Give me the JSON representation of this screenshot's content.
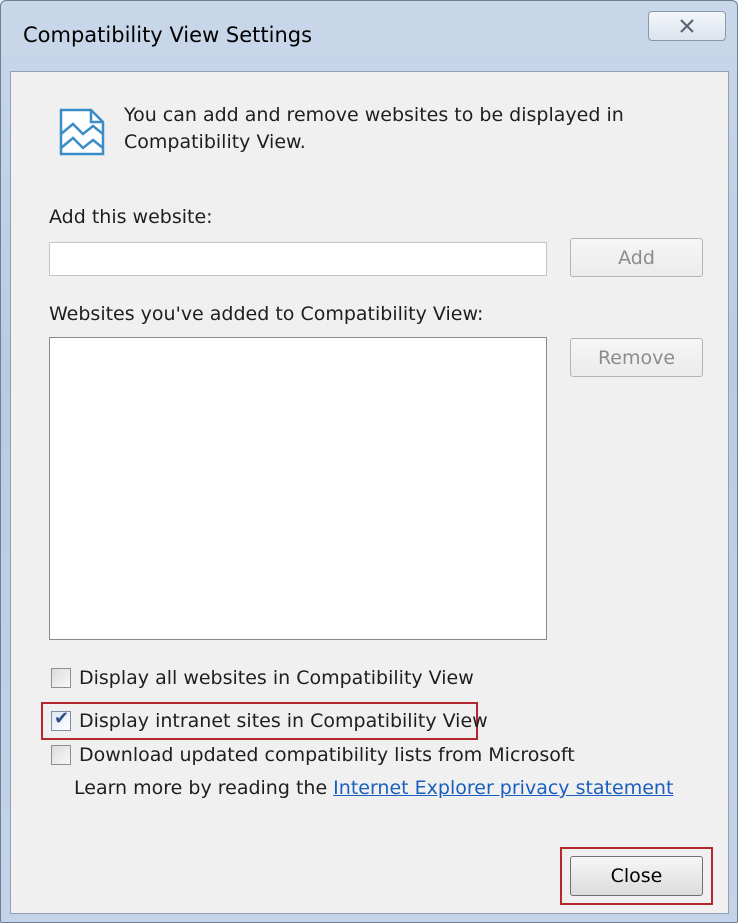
{
  "window": {
    "title": "Compatibility View Settings",
    "close_glyph": "☒"
  },
  "info": {
    "text": "You can add and remove websites to be displayed in Compatibility View."
  },
  "add_section": {
    "label": "Add this website:",
    "input_value": "",
    "add_button_label": "Add"
  },
  "list_section": {
    "label": "Websites you've added to Compatibility View:",
    "items": [],
    "remove_button_label": "Remove"
  },
  "options": {
    "display_all": {
      "label": "Display all websites in Compatibility View",
      "checked": false
    },
    "display_intranet": {
      "label": "Display intranet sites in Compatibility View",
      "checked": true
    },
    "download_lists": {
      "label": "Download updated compatibility lists from Microsoft",
      "checked": false
    }
  },
  "learn_more": {
    "prefix": "Learn more by reading the ",
    "link_text": "Internet Explorer privacy statement"
  },
  "footer": {
    "close_label": "Close"
  },
  "colors": {
    "highlight": "#b1282f",
    "link": "#1a5fbf"
  }
}
